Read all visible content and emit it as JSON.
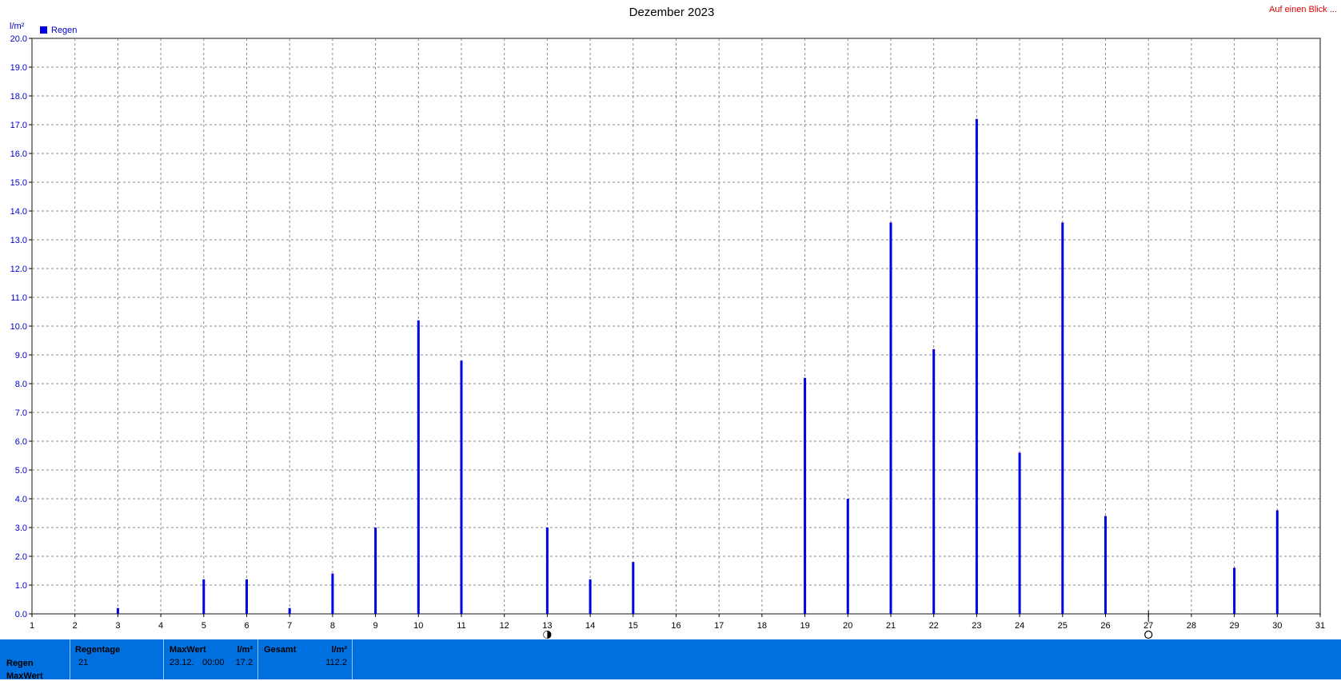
{
  "chart_data": {
    "type": "bar",
    "title": "Dezember 2023",
    "ylabel": "l/m²",
    "ylim": [
      0,
      20
    ],
    "y_ticks": [
      "0.0",
      "1.0",
      "2.0",
      "3.0",
      "4.0",
      "5.0",
      "6.0",
      "7.0",
      "8.0",
      "9.0",
      "10.0",
      "11.0",
      "12.0",
      "13.0",
      "14.0",
      "15.0",
      "16.0",
      "17.0",
      "18.0",
      "19.0",
      "20.0"
    ],
    "xlim": [
      1,
      31
    ],
    "x_ticks": [
      "1",
      "2",
      "3",
      "4",
      "5",
      "6",
      "7",
      "8",
      "9",
      "10",
      "11",
      "12",
      "13",
      "14",
      "15",
      "16",
      "17",
      "18",
      "19",
      "20",
      "21",
      "22",
      "23",
      "24",
      "25",
      "26",
      "27",
      "28",
      "29",
      "30",
      "31"
    ],
    "grid": true,
    "legend": {
      "position": "top-left",
      "entries": [
        "Regen"
      ]
    },
    "series": [
      {
        "name": "Regen",
        "color": "#0000e0",
        "points": [
          {
            "x": 3,
            "y": 0.2
          },
          {
            "x": 5,
            "y": 1.2
          },
          {
            "x": 6,
            "y": 1.2
          },
          {
            "x": 7,
            "y": 0.2
          },
          {
            "x": 8,
            "y": 1.4
          },
          {
            "x": 9,
            "y": 3.0
          },
          {
            "x": 10,
            "y": 10.2
          },
          {
            "x": 11,
            "y": 8.8
          },
          {
            "x": 13,
            "y": 3.0
          },
          {
            "x": 14,
            "y": 1.2
          },
          {
            "x": 15,
            "y": 1.8
          },
          {
            "x": 19,
            "y": 8.2
          },
          {
            "x": 20,
            "y": 4.0
          },
          {
            "x": 21,
            "y": 13.6
          },
          {
            "x": 22,
            "y": 9.2
          },
          {
            "x": 23,
            "y": 17.2
          },
          {
            "x": 24,
            "y": 5.6
          },
          {
            "x": 25,
            "y": 13.6
          },
          {
            "x": 26,
            "y": 3.4
          },
          {
            "x": 29,
            "y": 1.6
          },
          {
            "x": 30,
            "y": 3.6
          }
        ]
      }
    ],
    "moon_phases": [
      {
        "x": 13,
        "phase": "full-moon-icon"
      },
      {
        "x": 27,
        "phase": "new-moon-icon"
      }
    ]
  },
  "header": {
    "link": "Auf einen Blick ..."
  },
  "stats": {
    "row_labels": [
      "Regen",
      "MaxWert"
    ],
    "regentage": {
      "header": "Regentage",
      "value": "21"
    },
    "maxwert": {
      "header": "MaxWert",
      "unit": "l/m²",
      "date": "23.12.",
      "time": "00:00",
      "value": "17.2"
    },
    "gesamt": {
      "header": "Gesamt",
      "unit": "l/m²",
      "value": "112.2"
    }
  }
}
